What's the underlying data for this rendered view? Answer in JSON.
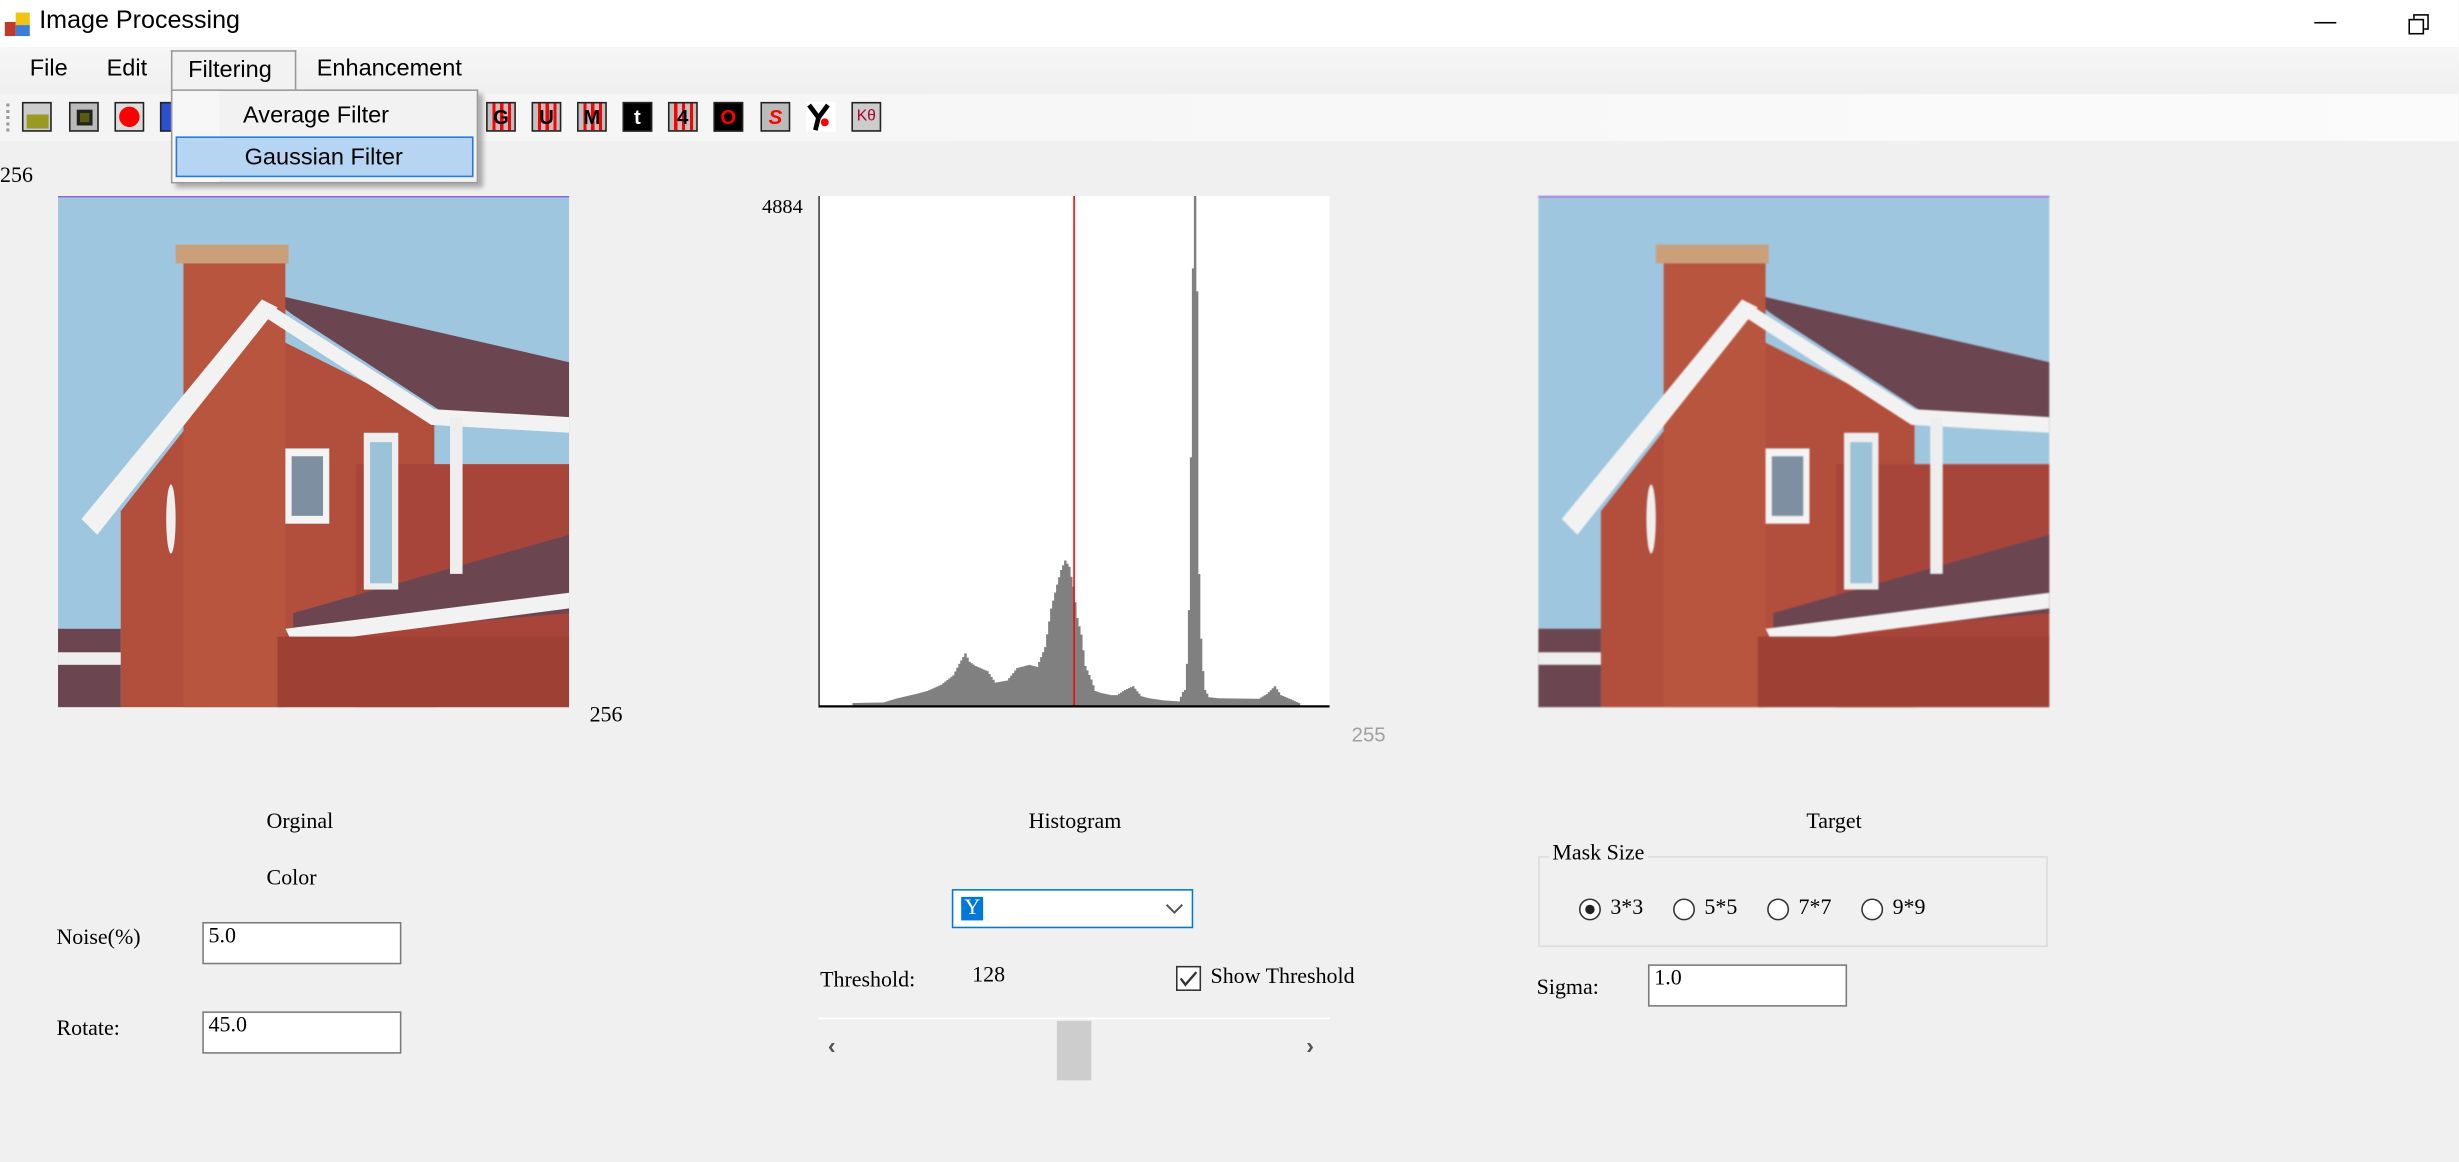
{
  "window": {
    "title": "Image Processing",
    "minimize_icon": "minimize-icon",
    "restore_icon": "restore-icon"
  },
  "menu": {
    "items": [
      "File",
      "Edit",
      "Filtering",
      "Enhancement"
    ],
    "open": "Filtering"
  },
  "dropdown": {
    "items": [
      "Average Filter",
      "Gaussian Filter"
    ],
    "highlighted": "Gaussian Filter"
  },
  "toolbar": {
    "icons": [
      "open-folder-icon",
      "save-icon",
      "red-circle-icon",
      "blue-icon",
      "g-icon",
      "u-icon",
      "m-icon",
      "t-icon",
      "four-icon",
      "o-icon",
      "s-icon",
      "y-icon",
      "k-theta-icon"
    ],
    "glyphs": {
      "g": "G",
      "u": "U",
      "m": "M",
      "t": "t",
      "four": "4",
      "o": "O",
      "s": "S",
      "k": "Kθ"
    }
  },
  "original": {
    "size_top": "256",
    "size_right": "256",
    "caption": "Orginal",
    "mode": "Color",
    "noise_label": "Noise(%)",
    "noise_value": "5.0",
    "rotate_label": "Rotate:",
    "rotate_value": "45.0"
  },
  "histogram": {
    "caption": "Histogram",
    "channel": "Y",
    "threshold_label": "Threshold:",
    "threshold_value": "128",
    "show_threshold_label": "Show Threshold",
    "show_threshold_checked": true,
    "slider_fraction": 0.5
  },
  "target": {
    "caption": "Target",
    "mask_size_label": "Mask Size",
    "mask_options": [
      "3*3",
      "5*5",
      "7*7",
      "9*9"
    ],
    "mask_selected": "3*3",
    "sigma_label": "Sigma:",
    "sigma_value": "1.0"
  },
  "chart_data": {
    "type": "bar",
    "title": "Histogram",
    "xlim": [
      0,
      255
    ],
    "ylim": [
      0,
      4884
    ],
    "ymax_label": "4884",
    "xmax_label": "255",
    "threshold": 128,
    "colors": {
      "bars": "#808080",
      "threshold": "#ff0000"
    },
    "keypoints_bin_count": [
      [
        0,
        0
      ],
      [
        16,
        0
      ],
      [
        17,
        25
      ],
      [
        32,
        30
      ],
      [
        39,
        70
      ],
      [
        48,
        110
      ],
      [
        54,
        140
      ],
      [
        61,
        200
      ],
      [
        67,
        290
      ],
      [
        70,
        400
      ],
      [
        73,
        500
      ],
      [
        75,
        420
      ],
      [
        78,
        380
      ],
      [
        84,
        330
      ],
      [
        88,
        220
      ],
      [
        94,
        240
      ],
      [
        99,
        360
      ],
      [
        105,
        390
      ],
      [
        109,
        370
      ],
      [
        113,
        560
      ],
      [
        116,
        930
      ],
      [
        119,
        1160
      ],
      [
        121,
        1300
      ],
      [
        123,
        1390
      ],
      [
        125,
        1330
      ],
      [
        127,
        1140
      ],
      [
        129,
        840
      ],
      [
        131,
        680
      ],
      [
        133,
        380
      ],
      [
        136,
        250
      ],
      [
        138,
        140
      ],
      [
        141,
        120
      ],
      [
        146,
        100
      ],
      [
        149,
        100
      ],
      [
        153,
        150
      ],
      [
        157,
        185
      ],
      [
        161,
        90
      ],
      [
        165,
        70
      ],
      [
        172,
        50
      ],
      [
        180,
        40
      ],
      [
        182,
        130
      ],
      [
        183,
        150
      ],
      [
        184,
        400
      ],
      [
        185,
        915
      ],
      [
        186,
        2380
      ],
      [
        187,
        4190
      ],
      [
        188,
        4884
      ],
      [
        189,
        3970
      ],
      [
        190,
        1260
      ],
      [
        191,
        640
      ],
      [
        192,
        330
      ],
      [
        193,
        150
      ],
      [
        195,
        80
      ],
      [
        200,
        70
      ],
      [
        220,
        65
      ],
      [
        224,
        110
      ],
      [
        228,
        185
      ],
      [
        231,
        100
      ],
      [
        236,
        60
      ],
      [
        240,
        25
      ],
      [
        241,
        0
      ],
      [
        255,
        0
      ]
    ]
  }
}
